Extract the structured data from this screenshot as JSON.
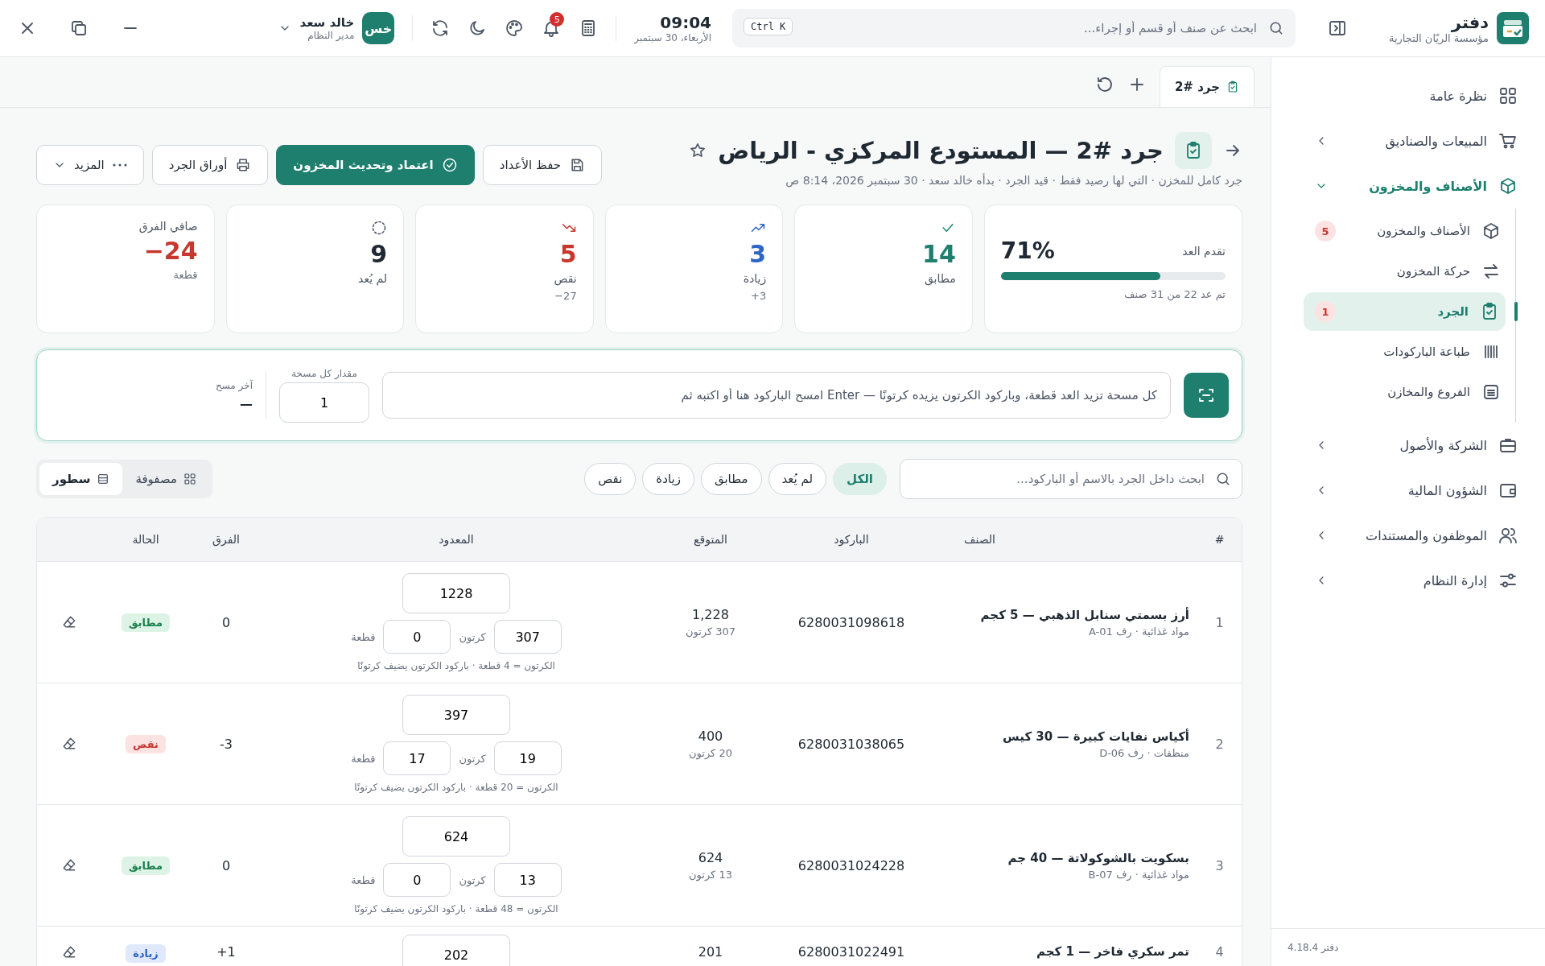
{
  "app": {
    "name": "دفتر",
    "company": "مؤسسة الريّان التجارية",
    "version": "دفتر 4.18.4"
  },
  "search": {
    "placeholder": "ابحث عن صنف أو قسم أو إجراء...",
    "shortcut": "Ctrl K"
  },
  "clock": {
    "time": "09:04",
    "date": "الأربعاء، 30 سبتمبر"
  },
  "notifications": {
    "count": "5"
  },
  "user": {
    "initials": "خس",
    "name": "خالد سعد",
    "role": "مدير النظام"
  },
  "sidebar": {
    "items": [
      {
        "kind": "link",
        "label": "نظرة عامة",
        "selected": false
      },
      {
        "kind": "group",
        "label": "المبيعات والصناديق",
        "expanded": false
      },
      {
        "kind": "group",
        "label": "الأصناف والمخزون",
        "expanded": true,
        "children": [
          {
            "label": "الأصناف والمخزون",
            "selected": false,
            "badge": "5"
          },
          {
            "label": "حركة المخزون",
            "selected": false
          },
          {
            "label": "الجرد",
            "selected": true,
            "badge": "1"
          },
          {
            "label": "طباعة الباركودات",
            "selected": false
          },
          {
            "label": "الفروع والمخازن",
            "selected": false
          }
        ]
      },
      {
        "kind": "group",
        "label": "الشركة والأصول",
        "expanded": false
      },
      {
        "kind": "group",
        "label": "الشؤون المالية",
        "expanded": false
      },
      {
        "kind": "group",
        "label": "الموظفون والمستندات",
        "expanded": false
      },
      {
        "kind": "group",
        "label": "إدارة النظام",
        "expanded": false
      }
    ]
  },
  "tabs": [
    {
      "label": "جرد #2",
      "selected": true
    }
  ],
  "page": {
    "title": "جرد #2 — المستودع المركزي - الرياض",
    "subtitle": "جرد كامل للمخزن · التي لها رصيد فقط · قيد الجرد · بدأه خالد سعد · 30 سبتمبر 2026، 8:14 ص",
    "starred": false,
    "buttons": [
      {
        "kind": "save",
        "label": "حفظ الأعداد"
      },
      {
        "kind": "primary",
        "label": "اعتماد وتحديث المخزون"
      },
      {
        "kind": "print",
        "label": "أوراق الجرد"
      },
      {
        "kind": "more",
        "label": "المزيد"
      }
    ]
  },
  "progress": {
    "label": "تقدم العد",
    "value": "71%",
    "level": 0.71,
    "note": "تم عد 22 من 31 صنف"
  },
  "stats": [
    {
      "kind": "match",
      "value": "14",
      "label": "مطابق"
    },
    {
      "kind": "over",
      "value": "3",
      "label": "زيادة",
      "note": "+3"
    },
    {
      "kind": "short",
      "value": "5",
      "label": "نقص",
      "note": "−27"
    },
    {
      "kind": "uncounted",
      "value": "9",
      "label": "لم يُعد"
    },
    {
      "kind": "net",
      "value": "−24",
      "label": "صافي الفرق",
      "note": "قطعة"
    }
  ],
  "scanner": {
    "placeholder": "كل مسحة تزيد العد قطعة، وباركود الكرتون يزيده كرتونًا — Enter امسح الباركود هنا أو اكتبه ثم",
    "qty_label": "مقدار كل مسحة",
    "qty": "1",
    "last_label": "آخر مسح",
    "last": "—"
  },
  "filters": {
    "placeholder": "ابحث داخل الجرد بالاسم أو الباركود...",
    "chips": [
      {
        "label": "الكل",
        "selected": true
      },
      {
        "label": "لم يُعد",
        "selected": false
      },
      {
        "label": "مطابق",
        "selected": false
      },
      {
        "label": "زيادة",
        "selected": false
      },
      {
        "label": "نقص",
        "selected": false
      }
    ],
    "views": [
      {
        "label": "مصفوفة",
        "selected": false
      },
      {
        "label": "سطور",
        "selected": true
      }
    ]
  },
  "table": {
    "columns": [
      "#",
      "الصنف",
      "الباركود",
      "المتوقع",
      "المعدود",
      "الفرق",
      "الحالة"
    ],
    "rows": [
      {
        "index": "1",
        "name": "أرز بسمتي سنابل الذهبي — 5 كجم",
        "meta": "مواد غذائية · رف A-01",
        "barcode": "6280031098618",
        "expected": "1,228",
        "expected_cartons": "307 كرتون",
        "counted": "1228",
        "cartons": "307",
        "carton_label": "كرتون",
        "pieces": "0",
        "piece_label": "قطعة",
        "hint": "الكرتون = 4 قطعة · باركود الكرتون يضيف كرتونًا",
        "diff": "0",
        "status": {
          "kind": "match",
          "label": "مطابق"
        }
      },
      {
        "index": "2",
        "name": "أكياس نفايات كبيرة — 30 كيس",
        "meta": "منظفات · رف D-06",
        "barcode": "6280031038065",
        "expected": "400",
        "expected_cartons": "20 كرتون",
        "counted": "397",
        "cartons": "19",
        "carton_label": "كرتون",
        "pieces": "17",
        "piece_label": "قطعة",
        "hint": "الكرتون = 20 قطعة · باركود الكرتون يضيف كرتونًا",
        "diff": "-3",
        "status": {
          "kind": "short",
          "label": "نقص"
        }
      },
      {
        "index": "3",
        "name": "بسكويت بالشوكولاتة — 40 جم",
        "meta": "مواد غذائية · رف B-07",
        "barcode": "6280031024228",
        "expected": "624",
        "expected_cartons": "13 كرتون",
        "counted": "624",
        "cartons": "13",
        "carton_label": "كرتون",
        "pieces": "0",
        "piece_label": "قطعة",
        "hint": "الكرتون = 48 قطعة · باركود الكرتون يضيف كرتونًا",
        "diff": "0",
        "status": {
          "kind": "match",
          "label": "مطابق"
        }
      },
      {
        "index": "4",
        "name": "تمر سكري فاخر — 1 كجم",
        "barcode": "6280031022491",
        "expected": "201",
        "counted": "202",
        "diff": "+1",
        "status": {
          "kind": "over",
          "label": "زيادة"
        }
      }
    ]
  }
}
